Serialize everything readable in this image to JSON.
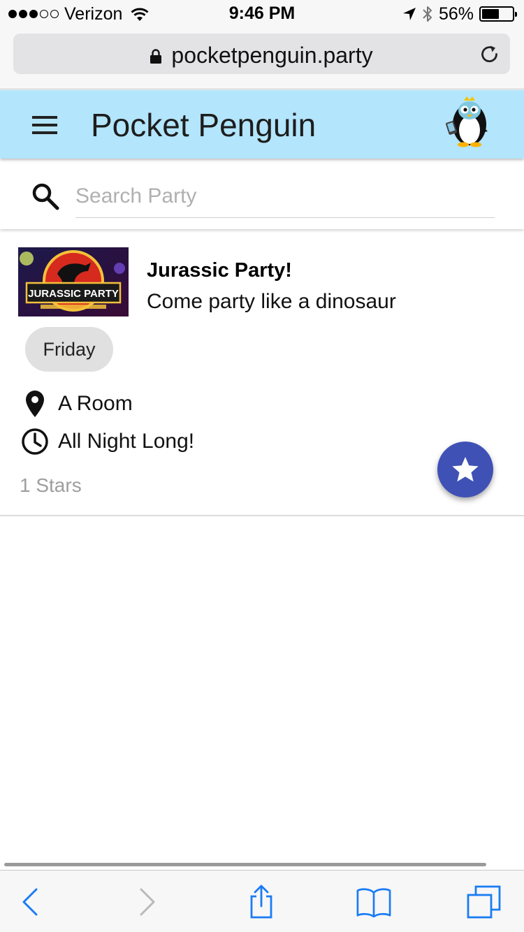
{
  "status_bar": {
    "carrier": "Verizon",
    "signal_bars_filled": 3,
    "signal_bars_total": 5,
    "time": "9:46 PM",
    "battery_percent": "56%",
    "battery_level": 0.56
  },
  "browser": {
    "url": "pocketpenguin.party"
  },
  "app_bar": {
    "title": "Pocket Penguin"
  },
  "search": {
    "placeholder": "Search Party",
    "value": ""
  },
  "party": {
    "image_text": "JURASSIC PARTY",
    "title": "Jurassic Party!",
    "description": "Come party like a dinosaur",
    "day": "Friday",
    "location": "A Room",
    "time": "All Night Long!",
    "stars_label": "1 Stars"
  },
  "icons": {
    "menu": "hamburger-menu-icon",
    "search": "search-icon",
    "location": "map-pin-icon",
    "time": "clock-icon",
    "star": "star-icon"
  },
  "colors": {
    "app_bar_bg": "#b3e5fc",
    "fab_bg": "#3f51b5",
    "safari_blue": "#1a7cf5",
    "chip_bg": "#e0e0e0",
    "muted_text": "#9e9e9e"
  }
}
